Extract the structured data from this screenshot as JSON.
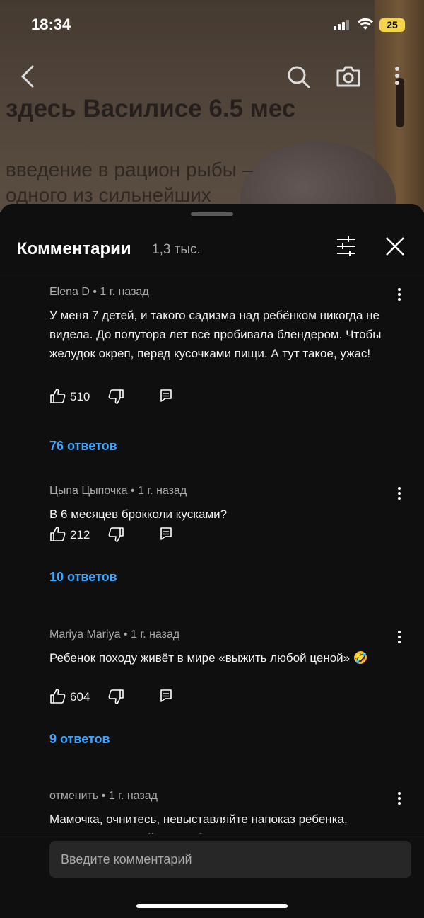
{
  "status_bar": {
    "time": "18:34",
    "battery": "25"
  },
  "video": {
    "title": "здесь Василисе 6.5 мес",
    "subtitle": "введение в рацион рыбы – одного из сильнейших"
  },
  "header": {
    "title": "Комментарии",
    "count": "1,3 тыс."
  },
  "comments": [
    {
      "author": "Elena D",
      "time": "1 г. назад",
      "text": "У меня 7 детей, и такого садизма над ребёнком никогда не видела.  До полутора лет всё пробивала блендером. Чтобы желудок окреп, перед кусочками пищи. А тут такое, ужас!",
      "likes": "510",
      "replies": "76 ответов"
    },
    {
      "author": "Цыпа Цыпочка",
      "time": "1 г. назад",
      "text": "В 6 месяцев брокколи кусками?",
      "likes": "212",
      "replies": "10 ответов"
    },
    {
      "author": "Mariya Mariya",
      "time": "1 г. назад",
      "text": "Ребенок походу живёт в мире «выжить любой ценой» 🤣",
      "likes": "604",
      "replies": "9 ответов"
    },
    {
      "author": "отменить",
      "time": "1 г. назад",
      "text": "Мамочка, очнитесь, невыставляйте напоказ ребенка, потихому, занимайтесь ребенком"
    }
  ],
  "input": {
    "placeholder": "Введите комментарий"
  },
  "icons": {
    "back": "back-arrow-icon",
    "search": "search-icon",
    "camera": "camera-icon",
    "more": "more-vertical-icon",
    "filter": "filter-icon",
    "close": "close-icon",
    "like": "thumbs-up-icon",
    "dislike": "thumbs-down-icon",
    "reply": "reply-icon"
  },
  "colors": {
    "background": "#0f0f0f",
    "link": "#3ea6ff",
    "battery": "#f2d34a"
  }
}
